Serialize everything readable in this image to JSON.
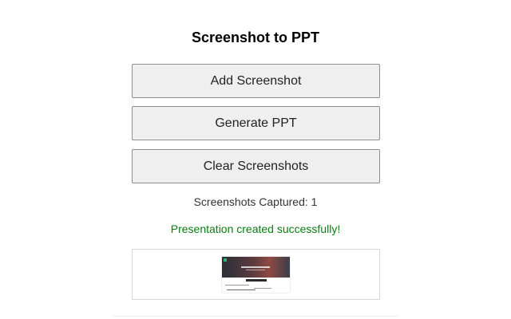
{
  "popup": {
    "title": "Screenshot to PPT",
    "buttons": {
      "add_label": "Add Screenshot",
      "generate_label": "Generate PPT",
      "clear_label": "Clear Screenshots"
    },
    "count_text": "Screenshots Captured: 1",
    "status_text": "Presentation created successfully!",
    "colors": {
      "status": "#0a7d14",
      "button_bg": "#efefef",
      "button_border": "#8f8f8f"
    }
  }
}
